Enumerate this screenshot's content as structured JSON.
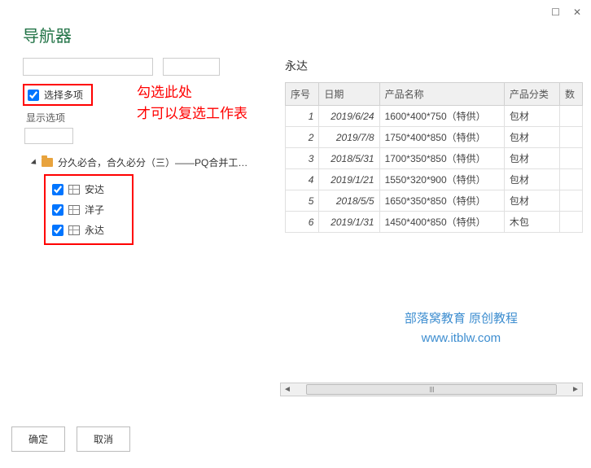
{
  "title": "导航器",
  "window_controls": {
    "maximize": "☐",
    "close": "✕"
  },
  "left": {
    "select_multi_label": "选择多项",
    "select_multi_checked": true,
    "display_options_label": "显示选项",
    "red_note_line1": "勾选此处",
    "red_note_line2": "才可以复选工作表",
    "tree_root": "分久必合，合久必分（三）——PQ合并工作表法...",
    "items": [
      {
        "label": "安达",
        "checked": true
      },
      {
        "label": "洋子",
        "checked": true
      },
      {
        "label": "永达",
        "checked": true
      }
    ]
  },
  "right": {
    "preview_title": "永达",
    "columns": [
      "序号",
      "日期",
      "产品名称",
      "产品分类",
      "数"
    ],
    "rows": [
      {
        "no": "1",
        "date": "2019/6/24",
        "name": "1600*400*750（特供）",
        "cat": "包材"
      },
      {
        "no": "2",
        "date": "2019/7/8",
        "name": "1750*400*850（特供）",
        "cat": "包材"
      },
      {
        "no": "3",
        "date": "2018/5/31",
        "name": "1700*350*850（特供）",
        "cat": "包材"
      },
      {
        "no": "4",
        "date": "2019/1/21",
        "name": "1550*320*900（特供）",
        "cat": "包材"
      },
      {
        "no": "5",
        "date": "2018/5/5",
        "name": "1650*350*850（特供）",
        "cat": "包材"
      },
      {
        "no": "6",
        "date": "2019/1/31",
        "name": "1450*400*850（特供）",
        "cat": "木包"
      }
    ]
  },
  "watermark": {
    "line1": "部落窝教育  原创教程",
    "line2": "www.itblw.com"
  },
  "footer": {
    "ok": "确定",
    "cancel": "取消"
  }
}
